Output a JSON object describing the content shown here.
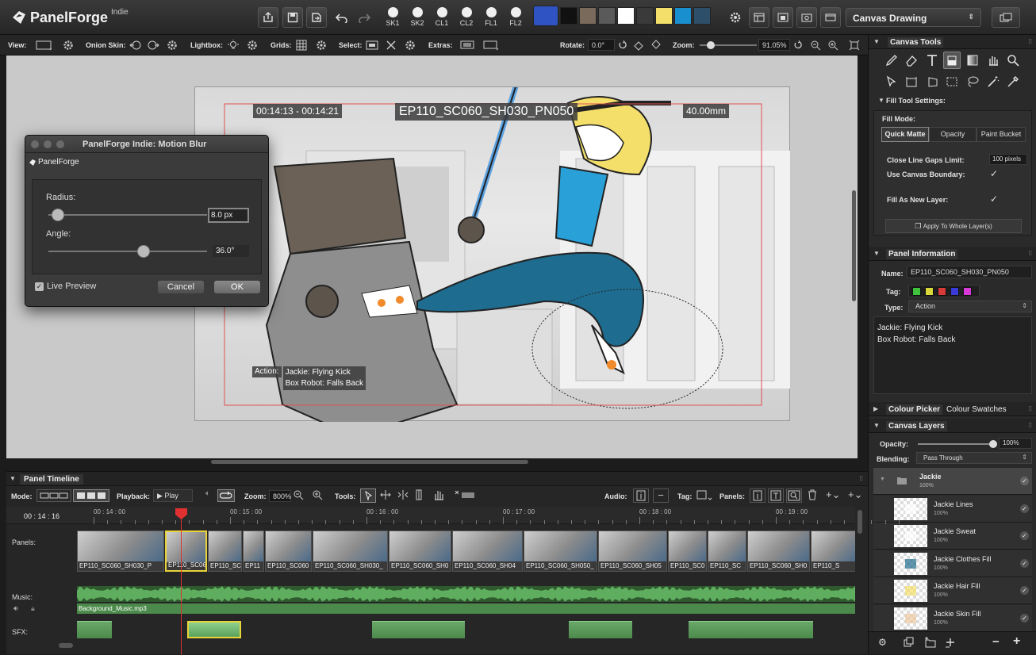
{
  "app": {
    "name": "PanelForge",
    "edition": "Indie"
  },
  "topbar": {
    "light_buttons": [
      "SK1",
      "SK2",
      "CL1",
      "CL2",
      "FL1",
      "FL2"
    ],
    "swatches": [
      "#2f53c2",
      "#111111",
      "#7a6a5c",
      "#5a5a5a",
      "#ffffff",
      "#3a3a3a",
      "#f3df6a",
      "#1a8fd0",
      "#2d4f6a"
    ],
    "workspace": "Canvas Drawing"
  },
  "toolbar": {
    "view_label": "View:",
    "onion_label": "Onion Skin:",
    "lightbox_label": "Lightbox:",
    "grids_label": "Grids:",
    "select_label": "Select:",
    "extras_label": "Extras:",
    "rotate_label": "Rotate:",
    "rotate_value": "0.0°",
    "zoom_label": "Zoom:",
    "zoom_value": "91.05%",
    "zoom_slider": 0.2
  },
  "canvas": {
    "timecode": "00:14:13 - 00:14:21",
    "panel_name": "EP110_SC060_SH030_PN050",
    "lens": "40.00mm",
    "caption_label": "Action:",
    "caption_lines": [
      "Jackie: Flying Kick",
      "Box Robot: Falls Back"
    ]
  },
  "dialog": {
    "title": "PanelForge Indie: Motion Blur",
    "brand": "PanelForge",
    "radius_label": "Radius:",
    "radius_value": "8.0 px",
    "radius_level": 0.06,
    "angle_label": "Angle:",
    "angle_value": "36.0°",
    "angle_level": 0.6,
    "live_preview": "Live Preview",
    "cancel": "Cancel",
    "ok": "OK"
  },
  "right": {
    "canvas_tools": "Canvas Tools",
    "fill_settings": "Fill Tool Settings:",
    "fill_mode": "Fill Mode:",
    "fill_tabs": [
      "Quick Matte",
      "Opacity",
      "Paint Bucket"
    ],
    "gaps_label": "Close Line Gaps Limit:",
    "gaps_value": "100 pixels",
    "boundary_label": "Use Canvas Boundary:",
    "new_layer_label": "Fill As New Layer:",
    "apply_btn": "Apply To Whole Layer(s)",
    "panel_info": "Panel Information",
    "name_label": "Name:",
    "name_value": "EP110_SC060_SH030_PN050",
    "tag_label": "Tag:",
    "tag_colors": [
      "#3ec23e",
      "#d8d83a",
      "#d83a3a",
      "#3a3ad8",
      "#d83ad8"
    ],
    "type_label": "Type:",
    "type_value": "Action",
    "notes": [
      "Jackie: Flying Kick",
      "Box Robot: Falls Back"
    ],
    "colour_picker": "Colour Picker",
    "colour_swatches": "Colour Swatches",
    "canvas_layers": "Canvas Layers",
    "opacity_label": "Opacity:",
    "opacity_value": "100%",
    "blending_label": "Blending:",
    "blending_value": "Pass Through",
    "group": {
      "name": "Jackie",
      "pct": "100%"
    },
    "layers": [
      {
        "name": "Jackie Lines",
        "pct": "100%"
      },
      {
        "name": "Jackie Sweat",
        "pct": "100%"
      },
      {
        "name": "Jackie Clothes Fill",
        "pct": "100%"
      },
      {
        "name": "Jackie Hair Fill",
        "pct": "100%"
      },
      {
        "name": "Jackie Skin Fill",
        "pct": "100%"
      }
    ]
  },
  "timeline": {
    "title": "Panel Timeline",
    "mode_label": "Mode:",
    "playback_label": "Playback:",
    "play": "Play",
    "zoom_label": "Zoom:",
    "zoom_value": "800%",
    "tools_label": "Tools:",
    "audio_label": "Audio:",
    "tag_label": "Tag:",
    "panels_label": "Panels:",
    "current_time": "00 : 14 : 16",
    "ruler": [
      "00 : 14 : 00",
      "00 : 15 : 00",
      "00 : 16 : 00",
      "00 : 17 : 00",
      "00 : 18 : 00",
      "00 : 19 : 00"
    ],
    "panels_track": "Panels:",
    "music_track": "Music:",
    "sfx_track": "SFX:",
    "music_file": "Background_Music.mp3",
    "panels": [
      "EP110_SC060_SH030_P",
      "EP110_SC06",
      "EP110_SC",
      "EP11",
      "EP110_SC060",
      "EP110_SC060_SH030_",
      "EP110_SC060_SH0",
      "EP110_SC060_SH04",
      "EP110_SC060_SH050_",
      "EP110_SC060_SH05",
      "EP110_SC0",
      "EP110_SC",
      "EP110_SC060_SH0",
      "EP110_S"
    ]
  }
}
